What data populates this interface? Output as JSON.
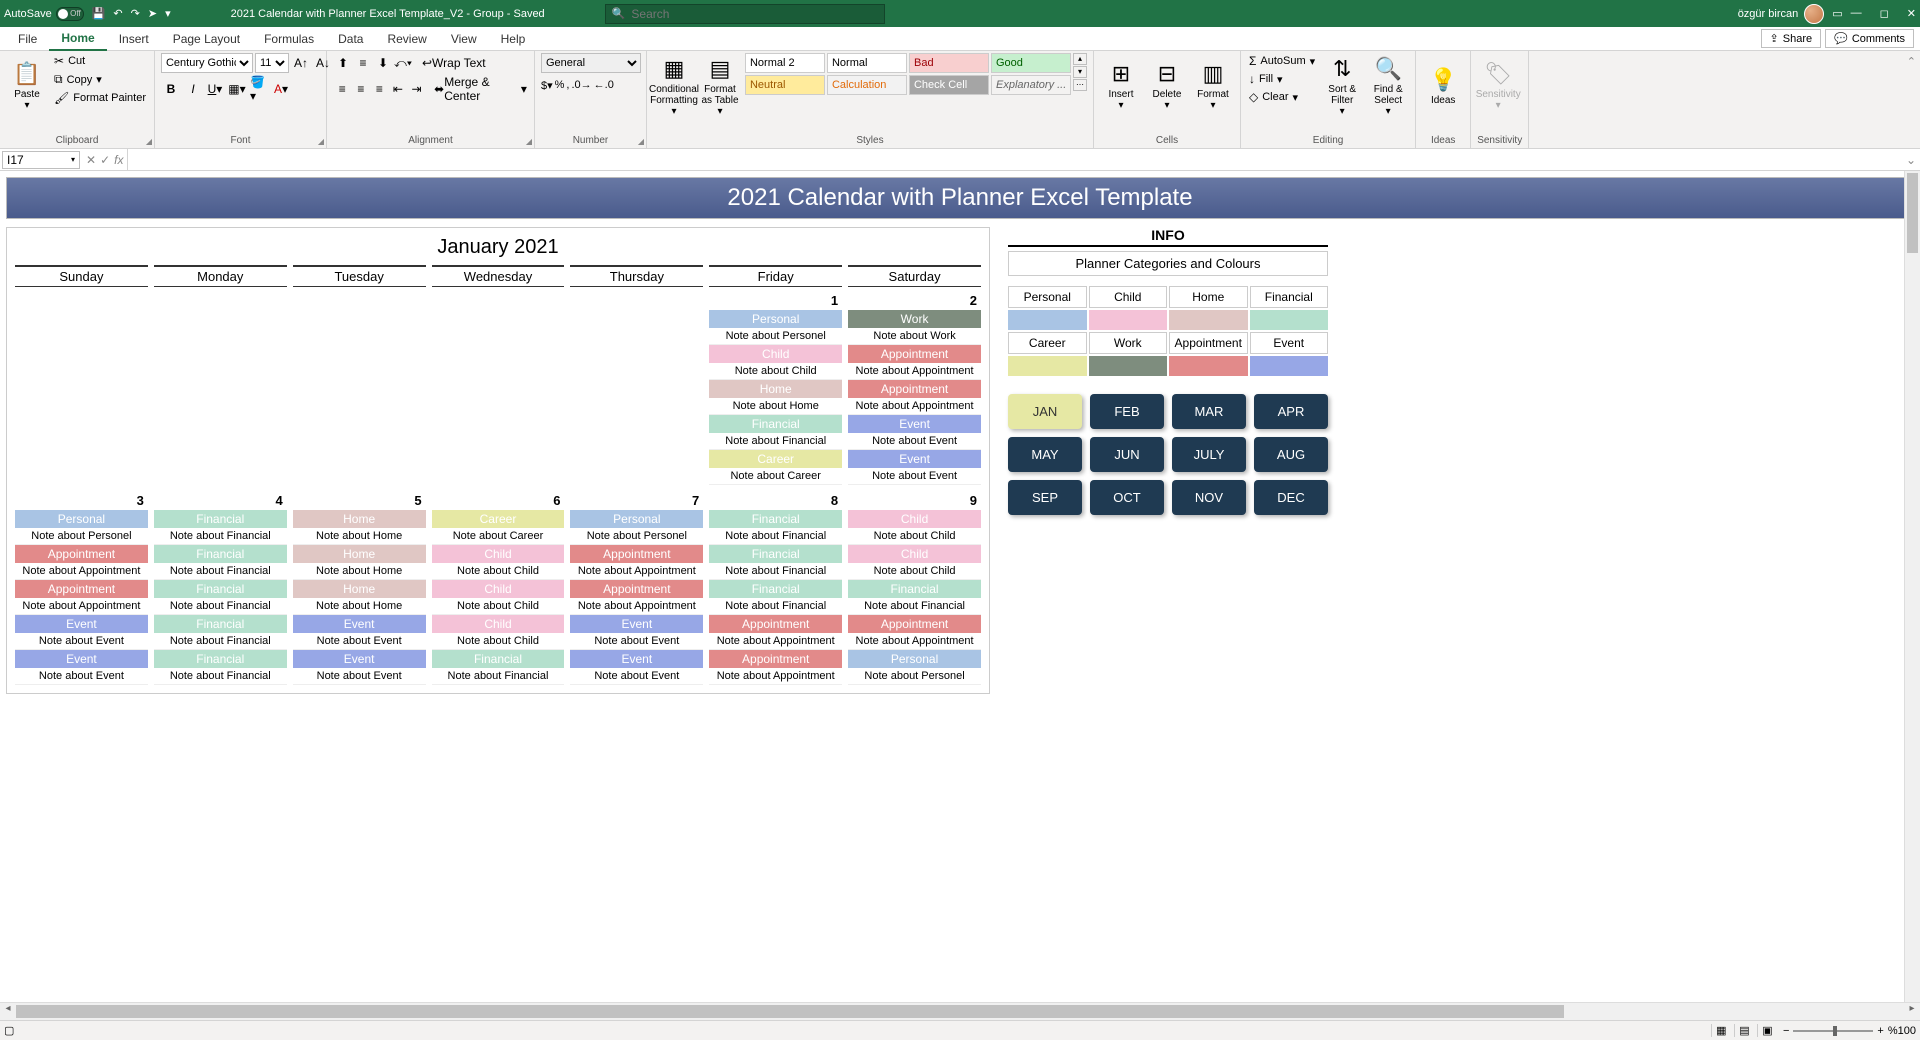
{
  "title_bar": {
    "autosave_label": "AutoSave",
    "autosave_state": "Off",
    "doc_title": "2021 Calendar with Planner Excel Template_V2  -  Group  -  Saved",
    "search_placeholder": "Search",
    "user_name": "özgür bircan"
  },
  "tabs": {
    "file": "File",
    "home": "Home",
    "insert": "Insert",
    "page_layout": "Page Layout",
    "formulas": "Formulas",
    "data": "Data",
    "review": "Review",
    "view": "View",
    "help": "Help",
    "share": "Share",
    "comments": "Comments"
  },
  "ribbon": {
    "clipboard": {
      "label": "Clipboard",
      "paste": "Paste",
      "cut": "Cut",
      "copy": "Copy",
      "format_painter": "Format Painter"
    },
    "font": {
      "label": "Font",
      "name": "Century Gothic",
      "size": "11"
    },
    "alignment": {
      "label": "Alignment",
      "wrap": "Wrap Text",
      "merge": "Merge & Center"
    },
    "number": {
      "label": "Number",
      "format": "General"
    },
    "styles": {
      "label": "Styles",
      "cond": "Conditional Formatting",
      "table": "Format as Table",
      "normal2": "Normal 2",
      "normal": "Normal",
      "bad": "Bad",
      "good": "Good",
      "neutral": "Neutral",
      "calculation": "Calculation",
      "check": "Check Cell",
      "explanatory": "Explanatory ..."
    },
    "cells": {
      "label": "Cells",
      "insert": "Insert",
      "delete": "Delete",
      "format": "Format"
    },
    "editing": {
      "label": "Editing",
      "autosum": "AutoSum",
      "fill": "Fill",
      "clear": "Clear",
      "sort": "Sort & Filter",
      "find": "Find & Select"
    },
    "ideas": {
      "label": "Ideas",
      "ideas": "Ideas"
    },
    "sensitivity": {
      "label": "Sensitivity",
      "sensitivity": "Sensitivity"
    }
  },
  "namebox": "I17",
  "sheet": {
    "banner": "2021 Calendar with Planner Excel Template",
    "month_title": "January 2021",
    "days": [
      "Sunday",
      "Monday",
      "Tuesday",
      "Wednesday",
      "Thursday",
      "Friday",
      "Saturday"
    ],
    "week1": {
      "fri": {
        "num": "1",
        "rows": [
          {
            "cat": "Personal",
            "cls": "c-personal",
            "note": "Note about Personel"
          },
          {
            "cat": "Child",
            "cls": "c-child",
            "note": "Note about Child"
          },
          {
            "cat": "Home",
            "cls": "c-home",
            "note": "Note about Home"
          },
          {
            "cat": "Financial",
            "cls": "c-financial",
            "note": "Note about Financial"
          },
          {
            "cat": "Career",
            "cls": "c-career",
            "note": "Note about Career"
          }
        ]
      },
      "sat": {
        "num": "2",
        "rows": [
          {
            "cat": "Work",
            "cls": "c-work",
            "note": "Note about Work"
          },
          {
            "cat": "Appointment",
            "cls": "c-appointment",
            "note": "Note about Appointment"
          },
          {
            "cat": "Appointment",
            "cls": "c-appointment",
            "note": "Note about Appointment"
          },
          {
            "cat": "Event",
            "cls": "c-event",
            "note": "Note about Event"
          },
          {
            "cat": "Event",
            "cls": "c-event",
            "note": "Note about Event"
          }
        ]
      }
    },
    "week2": [
      {
        "num": "3",
        "rows": [
          {
            "cat": "Personal",
            "cls": "c-personal",
            "note": "Note about Personel"
          },
          {
            "cat": "Appointment",
            "cls": "c-appointment",
            "note": "Note about Appointment"
          },
          {
            "cat": "Appointment",
            "cls": "c-appointment",
            "note": "Note about Appointment"
          },
          {
            "cat": "Event",
            "cls": "c-event",
            "note": "Note about Event"
          },
          {
            "cat": "Event",
            "cls": "c-event",
            "note": "Note about Event"
          }
        ]
      },
      {
        "num": "4",
        "rows": [
          {
            "cat": "Financial",
            "cls": "c-financial",
            "note": "Note about Financial"
          },
          {
            "cat": "Financial",
            "cls": "c-financial",
            "note": "Note about Financial"
          },
          {
            "cat": "Financial",
            "cls": "c-financial",
            "note": "Note about Financial"
          },
          {
            "cat": "Financial",
            "cls": "c-financial",
            "note": "Note about Financial"
          },
          {
            "cat": "Financial",
            "cls": "c-financial",
            "note": "Note about Financial"
          }
        ]
      },
      {
        "num": "5",
        "rows": [
          {
            "cat": "Home",
            "cls": "c-home",
            "note": "Note about Home"
          },
          {
            "cat": "Home",
            "cls": "c-home",
            "note": "Note about Home"
          },
          {
            "cat": "Home",
            "cls": "c-home",
            "note": "Note about Home"
          },
          {
            "cat": "Event",
            "cls": "c-event",
            "note": "Note about Event"
          },
          {
            "cat": "Event",
            "cls": "c-event",
            "note": "Note about Event"
          }
        ]
      },
      {
        "num": "6",
        "rows": [
          {
            "cat": "Career",
            "cls": "c-career",
            "note": "Note about Career"
          },
          {
            "cat": "Child",
            "cls": "c-child",
            "note": "Note about Child"
          },
          {
            "cat": "Child",
            "cls": "c-child",
            "note": "Note about Child"
          },
          {
            "cat": "Child",
            "cls": "c-child",
            "note": "Note about Child"
          },
          {
            "cat": "Financial",
            "cls": "c-financial",
            "note": "Note about Financial"
          }
        ]
      },
      {
        "num": "7",
        "rows": [
          {
            "cat": "Personal",
            "cls": "c-personal",
            "note": "Note about Personel"
          },
          {
            "cat": "Appointment",
            "cls": "c-appointment",
            "note": "Note about Appointment"
          },
          {
            "cat": "Appointment",
            "cls": "c-appointment",
            "note": "Note about Appointment"
          },
          {
            "cat": "Event",
            "cls": "c-event",
            "note": "Note about Event"
          },
          {
            "cat": "Event",
            "cls": "c-event",
            "note": "Note about Event"
          }
        ]
      },
      {
        "num": "8",
        "rows": [
          {
            "cat": "Financial",
            "cls": "c-financial",
            "note": "Note about Financial"
          },
          {
            "cat": "Financial",
            "cls": "c-financial",
            "note": "Note about Financial"
          },
          {
            "cat": "Financial",
            "cls": "c-financial",
            "note": "Note about Financial"
          },
          {
            "cat": "Appointment",
            "cls": "c-appointment",
            "note": "Note about Appointment"
          },
          {
            "cat": "Appointment",
            "cls": "c-appointment",
            "note": "Note about Appointment"
          }
        ]
      },
      {
        "num": "9",
        "rows": [
          {
            "cat": "Child",
            "cls": "c-child",
            "note": "Note about Child"
          },
          {
            "cat": "Child",
            "cls": "c-child",
            "note": "Note about Child"
          },
          {
            "cat": "Financial",
            "cls": "c-financial",
            "note": "Note about Financial"
          },
          {
            "cat": "Appointment",
            "cls": "c-appointment",
            "note": "Note about Appointment"
          },
          {
            "cat": "Personal",
            "cls": "c-personal",
            "note": "Note about Personel"
          }
        ]
      }
    ],
    "info": {
      "title": "INFO",
      "subtitle": "Planner Categories and Colours",
      "cats": [
        {
          "name": "Personal",
          "cls": "c-personal"
        },
        {
          "name": "Child",
          "cls": "c-child"
        },
        {
          "name": "Home",
          "cls": "c-home"
        },
        {
          "name": "Financial",
          "cls": "c-financial"
        },
        {
          "name": "Career",
          "cls": "c-career"
        },
        {
          "name": "Work",
          "cls": "c-work"
        },
        {
          "name": "Appointment",
          "cls": "c-appointment"
        },
        {
          "name": "Event",
          "cls": "c-event"
        }
      ],
      "months": [
        "JAN",
        "FEB",
        "MAR",
        "APR",
        "MAY",
        "JUN",
        "JULY",
        "AUG",
        "SEP",
        "OCT",
        "NOV",
        "DEC"
      ]
    }
  },
  "status": {
    "zoom": "%100"
  }
}
